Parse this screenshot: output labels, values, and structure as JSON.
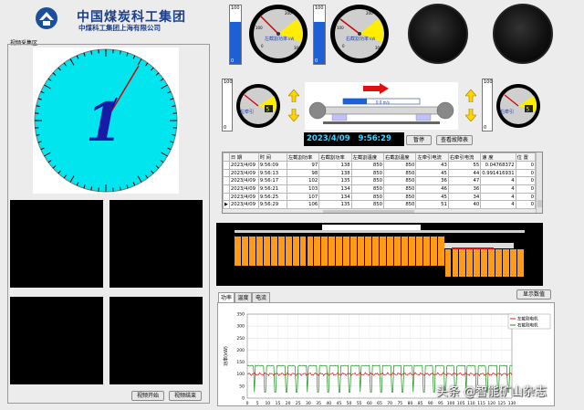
{
  "header": {
    "company_cn": "中国煤炭科工集团",
    "company_sub": "中煤科工集团上海有限公司"
  },
  "video": {
    "section_label": "视频采集区",
    "clock_numeral": "1",
    "start_button": "视频开始",
    "end_button": "视频结束"
  },
  "gauges_top": {
    "bar1": {
      "max": "100",
      "min": "0",
      "level": 0.72
    },
    "bar2": {
      "max": "100",
      "min": "0",
      "level": 0.72
    },
    "left_power": {
      "label": "左截割功率",
      "unit": "kW",
      "max": "300",
      "ticks": [
        "0",
        "100",
        "200",
        "300"
      ]
    },
    "right_power": {
      "label": "右截割功率",
      "unit": "kW",
      "max": "300",
      "ticks": [
        "0",
        "100",
        "200",
        "300"
      ]
    }
  },
  "gauges_mid": {
    "bar_left": {
      "max": "100",
      "min": "0",
      "level": 0.0
    },
    "bar_right": {
      "max": "100",
      "min": "0",
      "level": 0.0
    },
    "left_traction": {
      "label": "左牵引",
      "badge": "5"
    },
    "right_traction": {
      "label": "右牵引",
      "badge": "5"
    }
  },
  "status": {
    "datetime": "2023/4/09   9:56:29",
    "pause_button": "暂停",
    "fault_button": "查看故障表",
    "progress_text": "0  0 m/s"
  },
  "table": {
    "headers": [
      "日  期",
      "时  间",
      "左截割功率",
      "右截割功率",
      "左截割温度",
      "右截割温度",
      "左牵引电流",
      "右牵引电流",
      "速  度",
      "位  置"
    ],
    "rows": [
      [
        "2023/4/09",
        "9:56:09",
        "97",
        "138",
        "850",
        "850",
        "43",
        "55",
        "0.04768372",
        "0"
      ],
      [
        "2023/4/09",
        "9:56:13",
        "98",
        "138",
        "850",
        "850",
        "45",
        "44",
        "0.991416931",
        "0"
      ],
      [
        "2023/4/09",
        "9:56:17",
        "102",
        "135",
        "850",
        "850",
        "36",
        "47",
        "4",
        "0"
      ],
      [
        "2023/4/09",
        "9:56:21",
        "103",
        "134",
        "850",
        "850",
        "46",
        "36",
        "4",
        "0"
      ],
      [
        "2023/4/09",
        "9:56:25",
        "107",
        "134",
        "850",
        "850",
        "45",
        "34",
        "4",
        "0"
      ],
      [
        "2023/4/09",
        "9:56:29",
        "106",
        "135",
        "850",
        "850",
        "51",
        "40",
        "4",
        "0"
      ]
    ]
  },
  "chart_tabs": [
    "功率",
    "温度",
    "电流"
  ],
  "show_data_button": "显示数值",
  "chart_data": {
    "type": "line",
    "title": "",
    "xlabel": "",
    "ylabel": "功率(kW)",
    "xlim": [
      0,
      130
    ],
    "ylim": [
      0,
      350
    ],
    "x_ticks": [
      "0",
      "5",
      "10",
      "15",
      "20",
      "25",
      "30",
      "35",
      "40",
      "45",
      "50",
      "55",
      "60",
      "65",
      "70",
      "75",
      "80",
      "85",
      "90",
      "95",
      "100",
      "105",
      "110",
      "115",
      "120",
      "125",
      "130"
    ],
    "y_ticks": [
      "0",
      "50",
      "100",
      "150",
      "200",
      "250",
      "300",
      "350"
    ],
    "legend_position": "top-right",
    "series": [
      {
        "name": "左截割电机",
        "color": "#d62020",
        "baseline": 100
      },
      {
        "name": "右截割电机",
        "color": "#1f8a1f",
        "baseline": 135
      }
    ]
  },
  "watermark": "头条 @智能矿山杂志",
  "colors": {
    "clock_face": "#00e5ee",
    "bar_fill": "#1f5fd6",
    "machine_orange": "#ff9a1a",
    "gauge_yellow": "#ffee00"
  }
}
